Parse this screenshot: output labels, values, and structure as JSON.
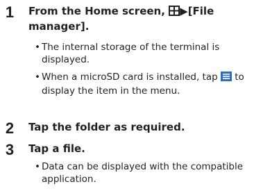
{
  "steps": [
    {
      "number": "1",
      "title_prefix": "From the Home screen, ",
      "title_icon": "apps-grid-icon",
      "title_arrow": "▶",
      "title_suffix": "[File manager].",
      "bullets": [
        {
          "text": "The internal storage of the terminal is displayed."
        },
        {
          "text_before": "When a microSD card is installed, tap ",
          "icon": "menu-icon",
          "text_after": " to display the item in the menu."
        }
      ]
    },
    {
      "number": "2",
      "title": "Tap the folder as required."
    },
    {
      "number": "3",
      "title": "Tap a file.",
      "bullets": [
        {
          "text": "Data can be displayed with the compatible application."
        }
      ]
    }
  ],
  "bullet_char": "•",
  "colors": {
    "text": "#231f20",
    "menu_icon": "#2b6cc4"
  }
}
